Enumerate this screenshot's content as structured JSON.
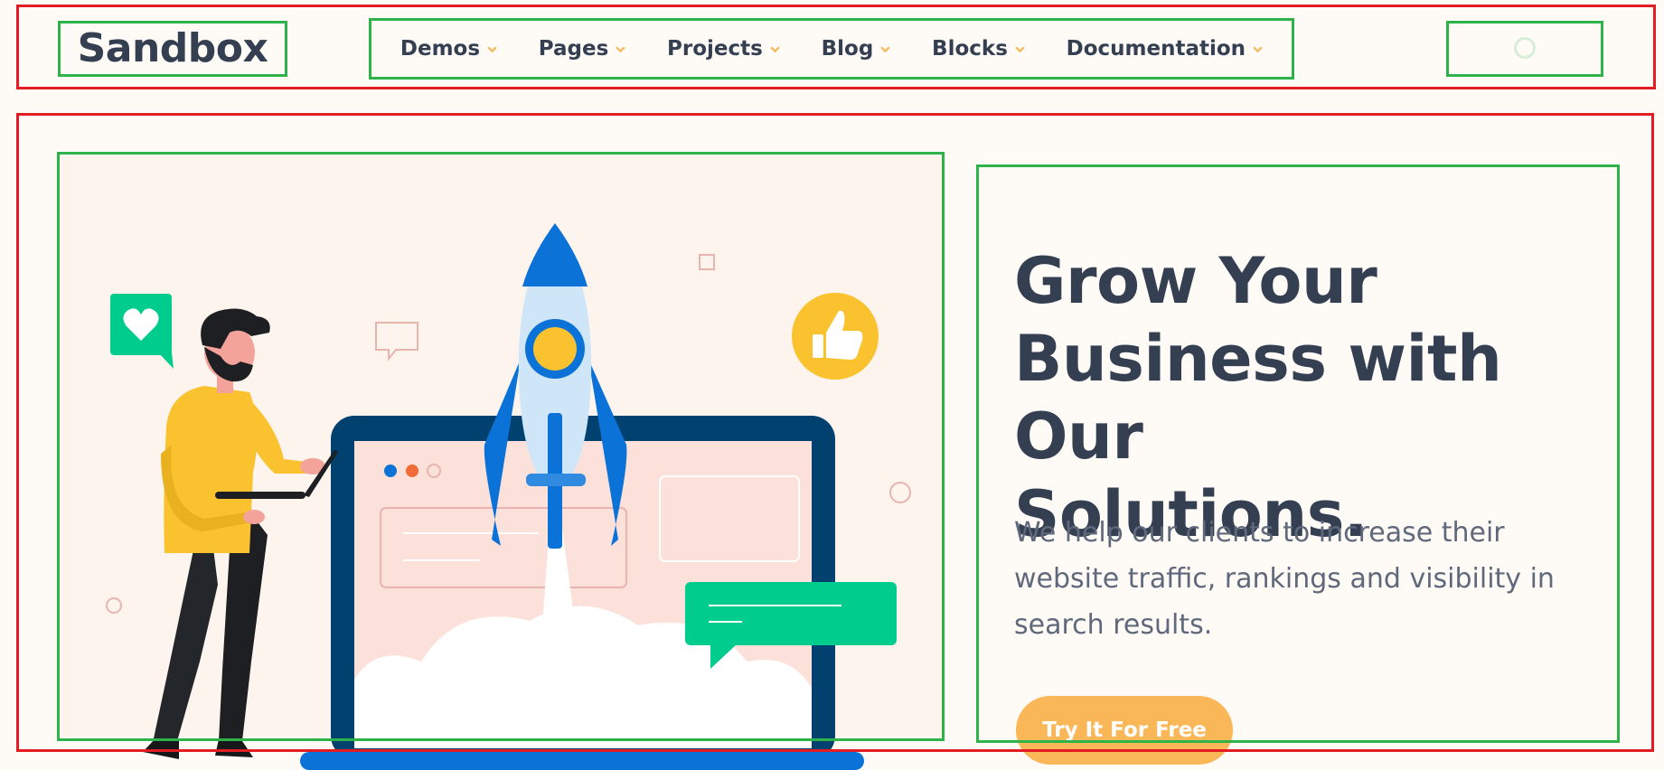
{
  "header": {
    "logo_text": "Sandbox",
    "nav": [
      {
        "label": "Demos"
      },
      {
        "label": "Pages"
      },
      {
        "label": "Projects"
      },
      {
        "label": "Blog"
      },
      {
        "label": "Blocks"
      },
      {
        "label": "Documentation"
      }
    ]
  },
  "hero": {
    "headline_line1": "Grow Your",
    "headline_line2": "Business with Our",
    "headline_line3": "Solutions.",
    "lead_line1": "We help our clients to increase their",
    "lead_line2": "website traffic, rankings and visibility in",
    "lead_line3": "search results.",
    "cta_label": "Try It For Free"
  },
  "colors": {
    "background": "#fefaf6",
    "text_dark": "#343f52",
    "text_muted": "#60697b",
    "accent_yellow": "#fab758",
    "chevron": "#fab758",
    "rocket_blue": "#0b72d8",
    "laptop_navy": "#00416f",
    "green": "#00cc8d",
    "annotation_red": "#e31b23",
    "annotation_green": "#2db34a"
  },
  "icons": {
    "nav_chevron": "chevron-down-icon",
    "heart_badge": "heart-icon",
    "thumbs_badge": "thumbs-up-icon",
    "search": "search-icon"
  }
}
